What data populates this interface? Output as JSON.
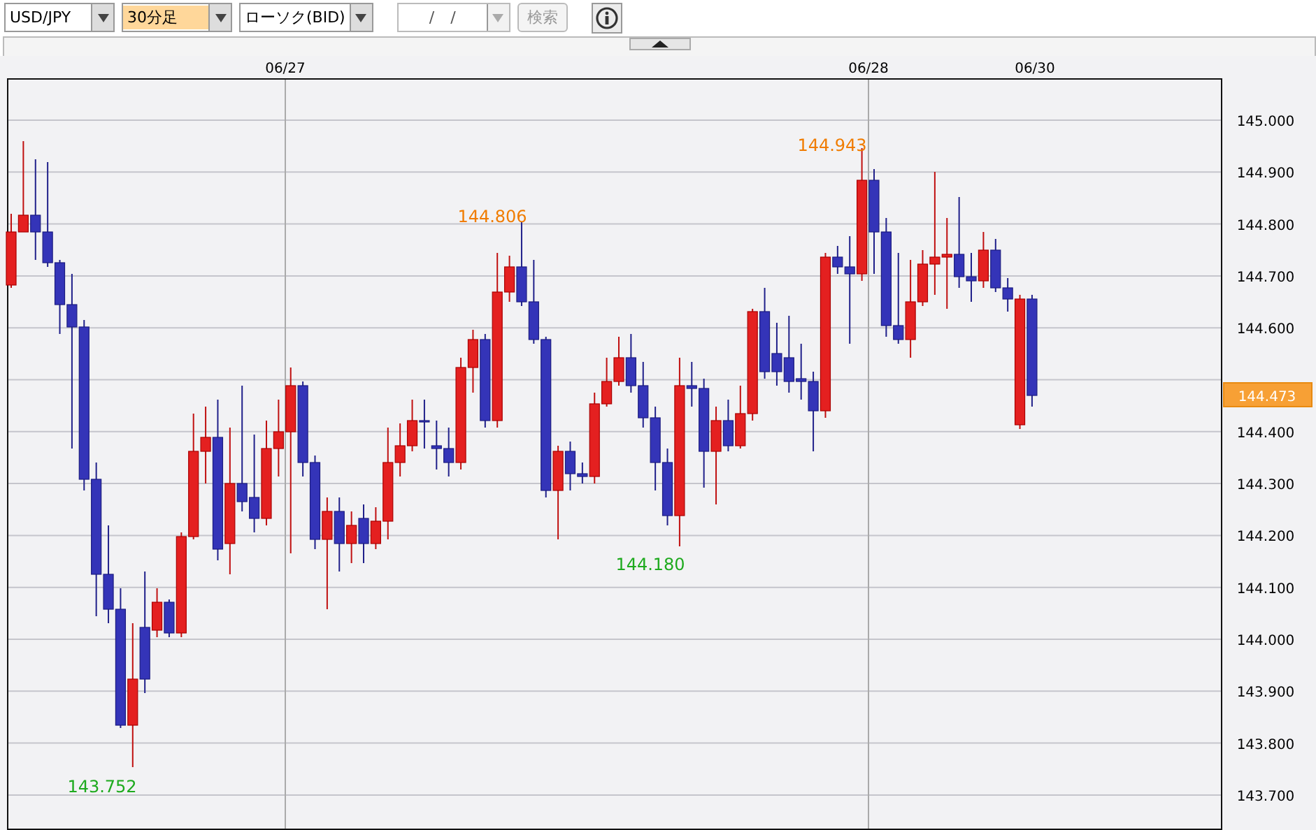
{
  "toolbar": {
    "currency": {
      "value": "USD/JPY",
      "highlighted": false
    },
    "interval": {
      "value": "30分足",
      "highlighted": true
    },
    "chart_type": {
      "value": "ローソク(BID)",
      "highlighted": false
    },
    "date_field": {
      "value": "/ /"
    },
    "search_button": {
      "label": "検索",
      "disabled": true
    }
  },
  "chart": {
    "date_labels": [
      "06/27",
      "06/28",
      "06/30"
    ],
    "price_ticks": [
      "145.000",
      "144.900",
      "144.800",
      "144.700",
      "144.600",
      "144.400",
      "144.300",
      "144.200",
      "144.100",
      "144.000",
      "143.900",
      "143.800",
      "143.700"
    ],
    "current_price": "144.473",
    "annotations": [
      {
        "kind": "high",
        "text": "144.806"
      },
      {
        "kind": "high",
        "text": "144.943"
      },
      {
        "kind": "low",
        "text": "144.180"
      },
      {
        "kind": "low",
        "text": "143.752"
      }
    ]
  }
}
